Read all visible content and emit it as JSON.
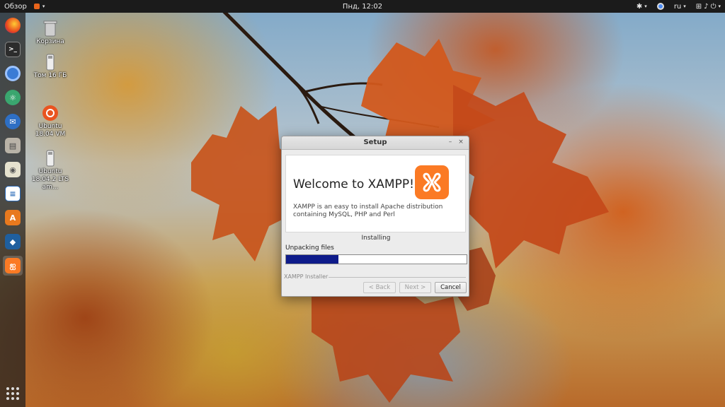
{
  "topbar": {
    "activities": "Обзор",
    "clock": "Пнд, 12:02",
    "language": "ru",
    "icons": [
      "accessibility-icon",
      "chrome-indicator-icon",
      "network-icon",
      "volume-icon",
      "power-icon"
    ]
  },
  "dock": {
    "apps": [
      "firefox",
      "terminal",
      "chromium",
      "atom",
      "thunderbird",
      "files",
      "rhythmbox",
      "libreoffice-writer",
      "software-center",
      "virtualbox",
      "xampp"
    ],
    "active": "xampp"
  },
  "desktop": {
    "icons": [
      {
        "label": "Корзина"
      },
      {
        "label": "Том 16 ГБ"
      },
      {
        "label": "Ubuntu 18.04 VM"
      },
      {
        "label": "Ubuntu 18.04.2 LTS am..."
      }
    ]
  },
  "window": {
    "title": "Setup",
    "minimize": "–",
    "close": "×",
    "welcome": "Welcome to XAMPP!",
    "description": "XAMPP is an easy to install Apache distribution containing MySQL, PHP and Perl",
    "status_label": "Installing",
    "progress_label": "Unpacking files",
    "progress_fraction": 0.29,
    "footer_label": "XAMPP Installer",
    "buttons": {
      "back": "< Back",
      "next": "Next >",
      "cancel": "Cancel"
    }
  },
  "colors": {
    "xampp_orange": "#fb7a24",
    "progress_fill": "#0e1b8a",
    "topbar": "#1b1b1b"
  }
}
